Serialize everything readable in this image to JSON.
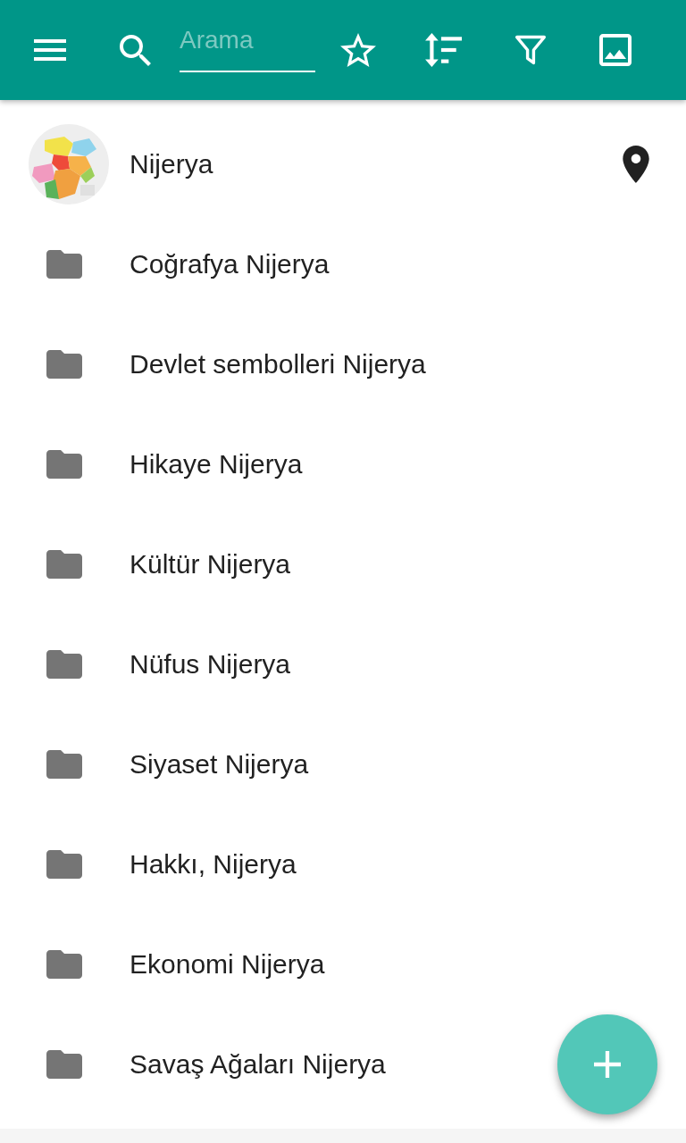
{
  "toolbar": {
    "search": {
      "placeholder": "Arama"
    }
  },
  "place": {
    "title": "Nijerya"
  },
  "folders": [
    {
      "label": "Coğrafya Nijerya"
    },
    {
      "label": "Devlet sembolleri Nijerya"
    },
    {
      "label": "Hikaye Nijerya"
    },
    {
      "label": "Kültür Nijerya"
    },
    {
      "label": "Nüfus Nijerya"
    },
    {
      "label": "Siyaset Nijerya"
    },
    {
      "label": "Hakkı, Nijerya"
    },
    {
      "label": "Ekonomi Nijerya"
    },
    {
      "label": "Savaş Ağaları Nijerya"
    }
  ]
}
